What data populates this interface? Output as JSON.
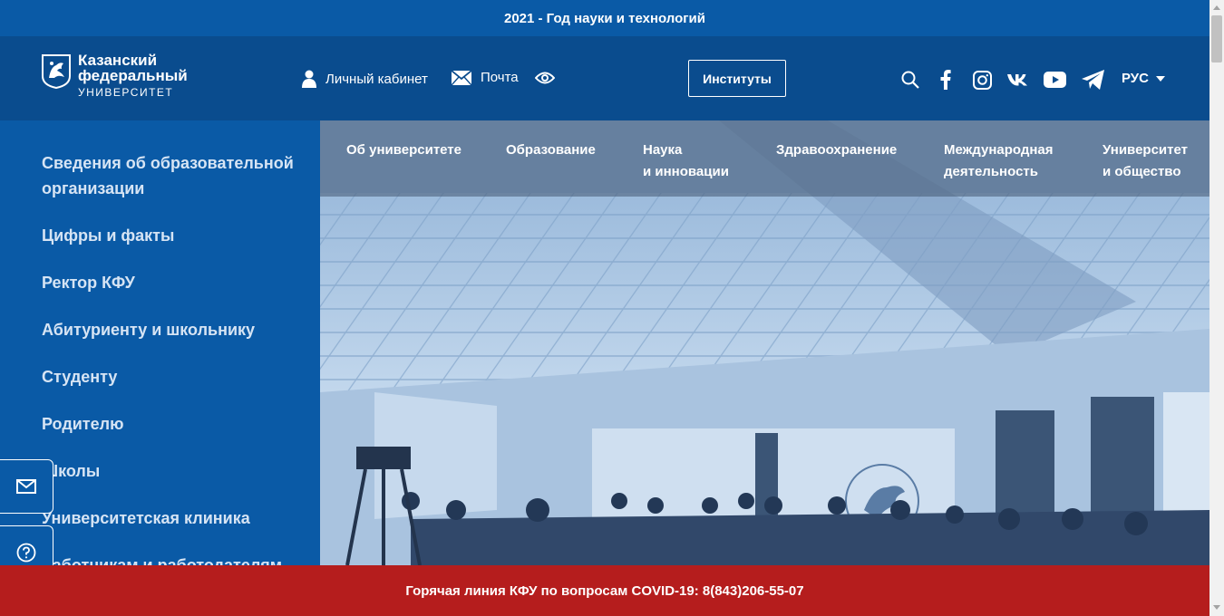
{
  "topbar": {
    "text": "2021 - Год науки и технологий"
  },
  "header": {
    "logo": {
      "line1": "Казанский",
      "line2": "федеральный",
      "line3": "УНИВЕРСИТЕТ"
    },
    "cabinet_label": "Личный кабинет",
    "mail_label": "Почта",
    "institutes_label": "Институты",
    "lang_label": "РУС",
    "icons": [
      "user-icon",
      "mail-icon",
      "eye-icon",
      "search-icon",
      "facebook-icon",
      "instagram-icon",
      "vk-icon",
      "youtube-icon",
      "telegram-icon"
    ]
  },
  "sidebar": {
    "items": [
      {
        "label": "Сведения об образовательной организации"
      },
      {
        "label": "Цифры и факты"
      },
      {
        "label": "Ректор КФУ"
      },
      {
        "label": "Абитуриенту и школьнику"
      },
      {
        "label": "Студенту"
      },
      {
        "label": "Родителю"
      },
      {
        "label": "Школы"
      },
      {
        "label": "Университетская клиника"
      },
      {
        "label": "Работникам и работодателям"
      }
    ]
  },
  "mainnav": {
    "items": [
      {
        "line1": "Об университете",
        "line2": ""
      },
      {
        "line1": "Образование",
        "line2": ""
      },
      {
        "line1": "Наука",
        "line2": "и инновации"
      },
      {
        "line1": "Здравоохранение",
        "line2": ""
      },
      {
        "line1": "Международная",
        "line2": "деятельность"
      },
      {
        "line1": "Университет",
        "line2": "и общество"
      }
    ]
  },
  "covid": {
    "text": "Горячая линия КФУ по вопросам COVID-19: 8(843)206-55-07"
  },
  "colors": {
    "brand_blue": "#0a5aa6",
    "header_blue": "#0a4c8e",
    "covid_red": "#b51d1d"
  }
}
